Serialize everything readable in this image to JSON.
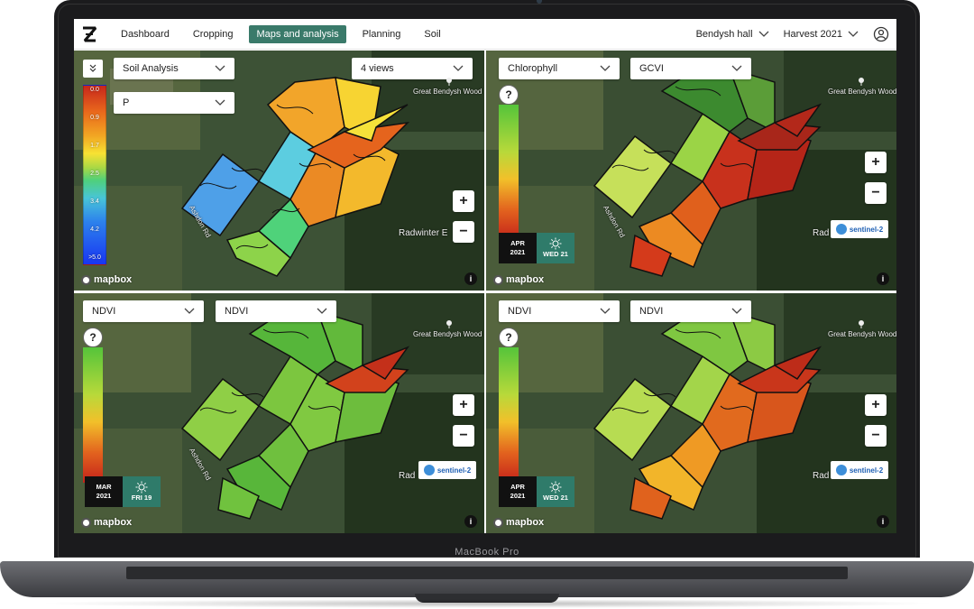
{
  "device": {
    "label": "MacBook Pro"
  },
  "nav": {
    "tabs": [
      {
        "label": "Dashboard"
      },
      {
        "label": "Cropping"
      },
      {
        "label": "Maps and analysis",
        "active": true
      },
      {
        "label": "Planning"
      },
      {
        "label": "Soil"
      }
    ],
    "farm": "Bendysh hall",
    "season": "Harvest 2021"
  },
  "colors": {
    "accent": "#3a7a6a",
    "sentinel_blue": "#1d5fb4"
  },
  "panels": {
    "p1": {
      "dropdown_primary": "Soil Analysis",
      "dropdown_secondary": "P",
      "dropdown_views": "4 views",
      "legend_ticks": [
        "0.0",
        "0.9",
        "1.7",
        "2.5",
        "3.4",
        "4.2",
        ">5.0"
      ],
      "place_wood": "Great Bendysh Wood",
      "place_radwinter": "Radwinter E",
      "road": "Ashdon Rd",
      "mapbox": "mapbox"
    },
    "p2": {
      "dropdown_primary": "Chlorophyll",
      "dropdown_secondary": "GCVI",
      "question": "?",
      "date_month": "APR",
      "date_year": "2021",
      "date_day": "WED 21",
      "sentinel": "sentinel-2",
      "place_wood": "Great Bendysh Wood",
      "place_rad": "Rad",
      "road": "Ashdon Rd",
      "mapbox": "mapbox"
    },
    "p3": {
      "dropdown_primary": "NDVI",
      "dropdown_secondary": "NDVI",
      "question": "?",
      "date_month": "MAR",
      "date_year": "2021",
      "date_day": "FRI 19",
      "sentinel": "sentinel-2",
      "place_wood": "Great Bendysh Wood",
      "place_rad": "Rad",
      "road": "Ashdon Rd",
      "mapbox": "mapbox"
    },
    "p4": {
      "dropdown_primary": "NDVI",
      "dropdown_secondary": "NDVI",
      "question": "?",
      "date_month": "APR",
      "date_year": "2021",
      "date_day": "WED 21",
      "sentinel": "sentinel-2",
      "place_wood": "Great Bendysh Wood",
      "place_rad": "Rad",
      "mapbox": "mapbox"
    }
  }
}
